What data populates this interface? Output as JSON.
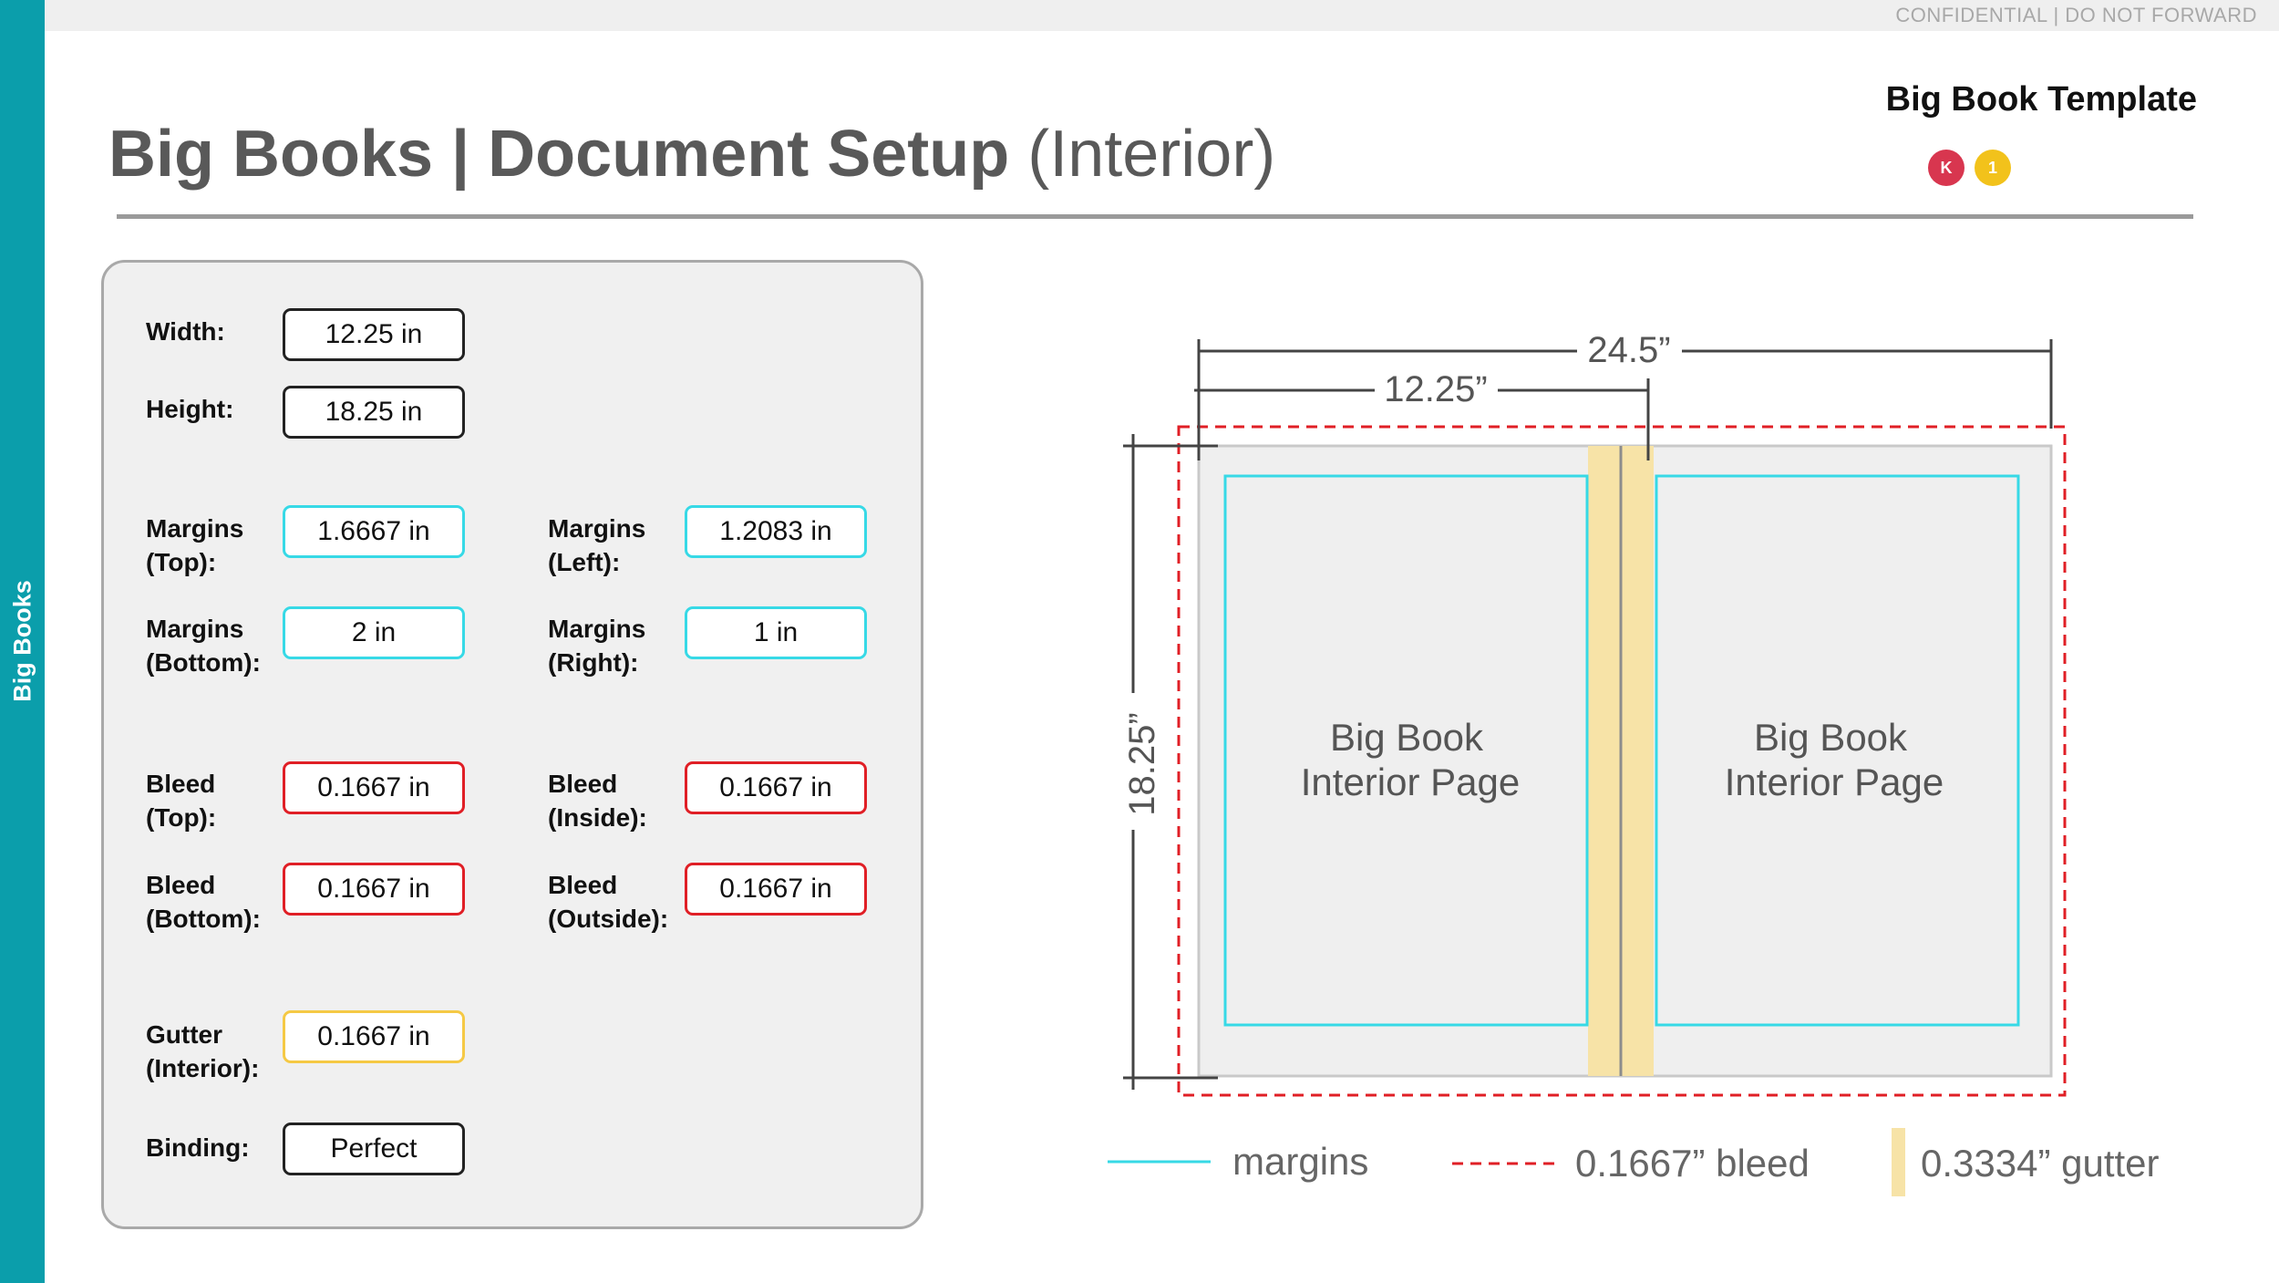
{
  "header": {
    "confidential": "CONFIDENTIAL | DO NOT FORWARD",
    "title_bold": "Big Books | Document Setup",
    "title_light": "(Interior)",
    "template_label": "Big Book Template",
    "badges": [
      "K",
      "1"
    ]
  },
  "sidebar": {
    "label": "Big Books"
  },
  "colors": {
    "accent": "#0b9eab",
    "margin": "#37d9e6",
    "bleed": "#e01f26",
    "gutter": "#f5c945",
    "badge_k": "#d8364f",
    "badge_1": "#f2c21b"
  },
  "settings": {
    "width": {
      "label": "Width:",
      "value": "12.25 in"
    },
    "height": {
      "label": "Height:",
      "value": "18.25 in"
    },
    "margins_top": {
      "label1": "Margins",
      "label2": "(Top):",
      "value": "1.6667 in"
    },
    "margins_left": {
      "label1": "Margins",
      "label2": "(Left):",
      "value": "1.2083 in"
    },
    "margins_bottom": {
      "label1": "Margins",
      "label2": "(Bottom):",
      "value": "2 in"
    },
    "margins_right": {
      "label1": "Margins",
      "label2": "(Right):",
      "value": "1 in"
    },
    "bleed_top": {
      "label1": "Bleed",
      "label2": "(Top):",
      "value": "0.1667 in"
    },
    "bleed_inside": {
      "label1": "Bleed",
      "label2": "(Inside):",
      "value": "0.1667 in"
    },
    "bleed_bottom": {
      "label1": "Bleed",
      "label2": "(Bottom):",
      "value": "0.1667 in"
    },
    "bleed_outside": {
      "label1": "Bleed",
      "label2": "(Outside):",
      "value": "0.1667 in"
    },
    "gutter": {
      "label1": "Gutter",
      "label2": "(Interior):",
      "value": "0.1667 in"
    },
    "binding": {
      "label": "Binding:",
      "value": "Perfect"
    }
  },
  "diagram": {
    "spread_width": "24.5”",
    "page_width": "12.25”",
    "page_height": "18.25”",
    "left_page_line1": "Big Book",
    "left_page_line2": "Interior Page",
    "right_page_line1": "Big Book",
    "right_page_line2": "Interior Page"
  },
  "legend": {
    "margins": "margins",
    "bleed": "0.1667” bleed",
    "gutter": "0.3334” gutter"
  }
}
